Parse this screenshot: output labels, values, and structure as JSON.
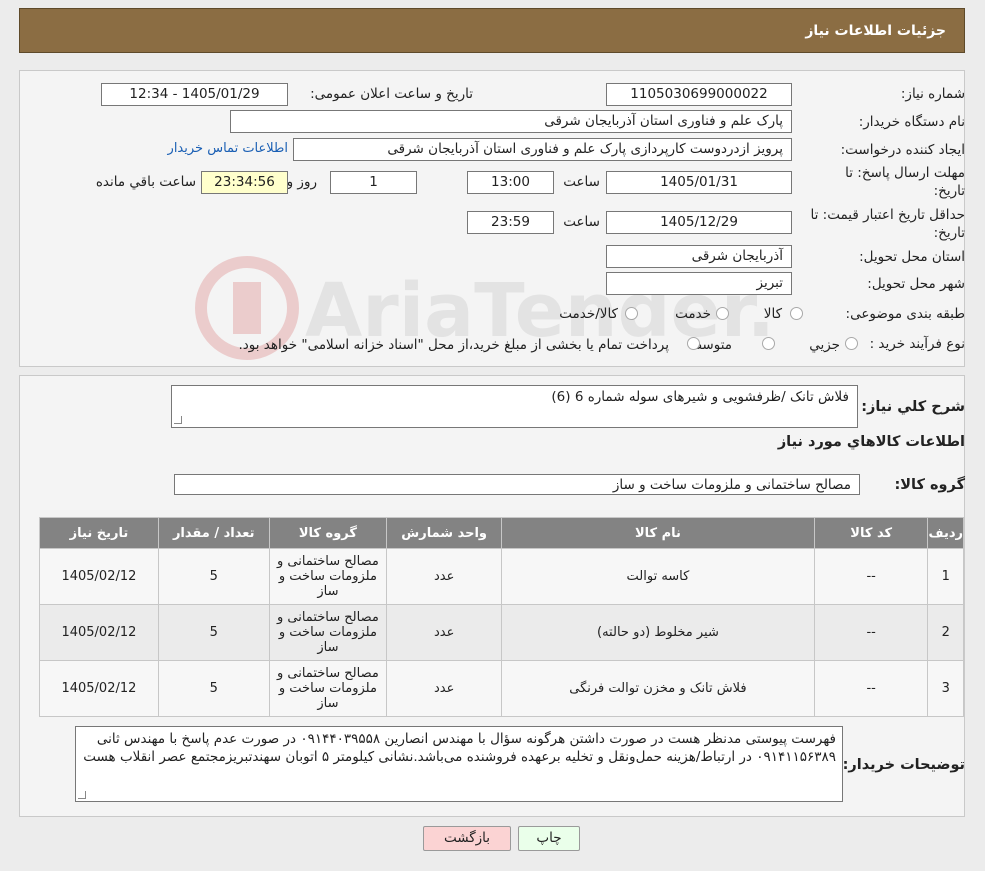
{
  "header": {
    "title": "جزئیات اطلاعات نیاز"
  },
  "form": {
    "need_number_label": "شماره نیاز:",
    "need_number": "1105030699000022",
    "announce_label": "تاریخ و ساعت اعلان عمومی:",
    "announce_value": "1405/01/29 - 12:34",
    "buyer_org_label": "نام دستگاه خریدار:",
    "buyer_org": "پارک علم و فناوری استان آذربایجان شرقی",
    "requester_label": "ایجاد کننده درخواست:",
    "requester": "پرویز ازدردوست کارپردازی پارک علم و فناوری استان آذربایجان شرقی",
    "contact_link": "اطلاعات تماس خریدار",
    "deadline_label_1": "مهلت ارسال پاسخ: تا",
    "deadline_label_2": "تاریخ:",
    "deadline_date": "1405/01/31",
    "time_label": "ساعت",
    "deadline_time": "13:00",
    "days_value": "1",
    "days_label": "روز و",
    "remaining_time": "23:34:56",
    "remaining_label": "ساعت باقي مانده",
    "validity_label_1": "حداقل تاریخ اعتبار قیمت: تا",
    "validity_label_2": "تاریخ:",
    "validity_date": "1405/12/29",
    "validity_time": "23:59",
    "province_label": "استان محل تحویل:",
    "province": "آذربایجان شرقی",
    "city_label": "شهر محل تحویل:",
    "city": "تبریز",
    "category_label": "طبقه بندی موضوعی:",
    "category_options": [
      "کالا",
      "خدمت",
      "کالا/خدمت"
    ],
    "process_label": "نوع فرآیند خرید :",
    "process_options": [
      "جزيي",
      "متوسط"
    ],
    "process_note": "پرداخت تمام یا بخشی از مبلغ خرید،از محل \"اسناد خزانه اسلامی\" خواهد بود."
  },
  "details": {
    "summary_label": "شرح کلي نياز:",
    "summary": "فلاش تانک /ظرفشویی و شیرهای سوله شماره 6 (6)",
    "goods_info_title": "اطلاعات کالاهاي مورد نياز",
    "goods_group_label": "گروه کالا:",
    "goods_group": "مصالح ساختمانی و ملزومات ساخت و ساز"
  },
  "table": {
    "headers": [
      "رديف",
      "کد کالا",
      "نام کالا",
      "واحد شمارش",
      "گروه کالا",
      "تعداد / مقدار",
      "تاریخ نیاز"
    ],
    "rows": [
      [
        "1",
        "--",
        "کاسه توالت",
        "عدد",
        "مصالح ساختمانی و ملزومات ساخت و ساز",
        "5",
        "1405/02/12"
      ],
      [
        "2",
        "--",
        "شیر مخلوط (دو حالته)",
        "عدد",
        "مصالح ساختمانی و ملزومات ساخت و ساز",
        "5",
        "1405/02/12"
      ],
      [
        "3",
        "--",
        "فلاش تانک و مخزن توالت فرنگی",
        "عدد",
        "مصالح ساختمانی و ملزومات ساخت و ساز",
        "5",
        "1405/02/12"
      ]
    ]
  },
  "buyer_notes": {
    "label": "توضیحات خریدار:",
    "text": "فهرست پیوستی مدنظر هست در صورت داشتن هرگونه سؤال با مهندس انصارین ۰۹۱۴۴۰۳۹۵۵۸ در صورت عدم پاسخ با مهندس ثانی ۰۹۱۴۱۱۵۶۳۸۹ در ارتباط/هزینه حمل‌ونقل و تخلیه برعهده فروشنده می‌باشد.نشانی کیلومتر ۵ اتوبان سهندتبریزمجتمع عصر انقلاب هست"
  },
  "buttons": {
    "print": "چاپ",
    "back": "بازگشت"
  },
  "watermark": {
    "text": "AriaTender.neT"
  },
  "colors": {
    "header_bg": "#8b6d43",
    "back_button_bg": "#fbd3d3",
    "print_button_bg": "#eaffea"
  }
}
